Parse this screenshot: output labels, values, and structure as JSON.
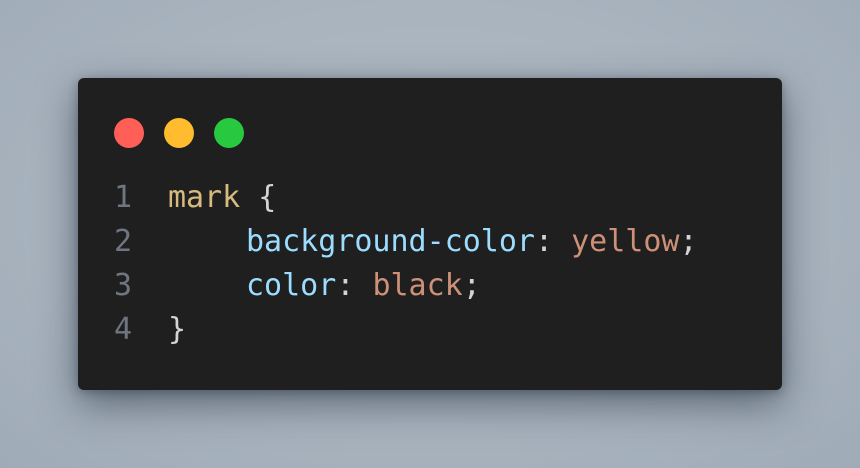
{
  "colors": {
    "close": "#ff5f57",
    "minimize": "#febc2e",
    "maximize": "#28c840",
    "editor_bg": "#1f1f1f",
    "line_number": "#6e7681",
    "selector": "#d7ba7d",
    "property": "#9cdcfe",
    "value": "#ce9178",
    "punctuation": "#d4d4d4"
  },
  "code": {
    "lines": [
      {
        "number": "1",
        "selector": "mark",
        "open_brace": " {"
      },
      {
        "number": "2",
        "property": "background-color",
        "colon": ": ",
        "value": "yellow",
        "semicolon": ";"
      },
      {
        "number": "3",
        "property": "color",
        "colon": ": ",
        "value": "black",
        "semicolon": ";"
      },
      {
        "number": "4",
        "close_brace": "}"
      }
    ]
  }
}
